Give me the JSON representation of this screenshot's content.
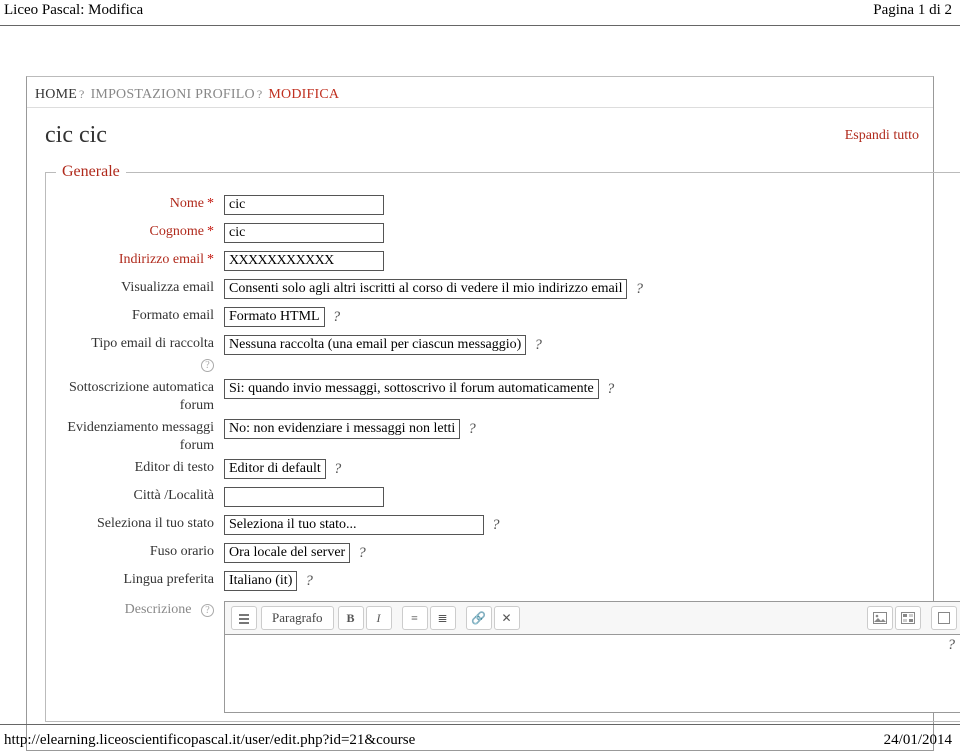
{
  "header": {
    "title_left": "Liceo Pascal: Modifica",
    "page_indicator": "Pagina 1 di 2"
  },
  "tabs": {
    "home": "HOME",
    "impostazioni": "IMPOSTAZIONI PROFILO",
    "modifica": "MODIFICA"
  },
  "page_heading": "cic cic",
  "expand_all": "Espandi tutto",
  "section": {
    "legend": "Generale",
    "rows": {
      "nome": {
        "label": "Nome",
        "value": "cic"
      },
      "cognome": {
        "label": "Cognome",
        "value": "cic"
      },
      "email": {
        "label": "Indirizzo email",
        "value": "XXXXXXXXXXX"
      },
      "visualizza": {
        "label": "Visualizza email",
        "value": "Consenti solo agli altri iscritti al corso di vedere il mio indirizzo email"
      },
      "formato": {
        "label": "Formato email",
        "value": "Formato HTML"
      },
      "raccolta": {
        "label": "Tipo email di raccolta",
        "value": "Nessuna raccolta (una email per ciascun messaggio)"
      },
      "sottoscrizione": {
        "label": "Sottoscrizione automatica forum",
        "value": "Si: quando invio messaggi, sottoscrivo il forum automaticamente"
      },
      "evidenziamento": {
        "label": "Evidenziamento messaggi forum",
        "value": "No: non evidenziare i messaggi non letti"
      },
      "editor": {
        "label": "Editor di testo",
        "value": "Editor di default"
      },
      "citta": {
        "label": "Città /Località",
        "value": ""
      },
      "stato": {
        "label": "Seleziona il tuo stato",
        "value": "Seleziona il tuo stato..."
      },
      "fuso": {
        "label": "Fuso orario",
        "value": "Ora locale del server"
      },
      "lingua": {
        "label": "Lingua preferita",
        "value": "Italiano (it)"
      },
      "descrizione": {
        "label": "Descrizione"
      }
    }
  },
  "editor_toolbar": {
    "paragraph": "Paragrafo"
  },
  "footer": {
    "url": "http://elearning.liceoscientificopascal.it/user/edit.php?id=21&course",
    "date": "24/01/2014"
  }
}
